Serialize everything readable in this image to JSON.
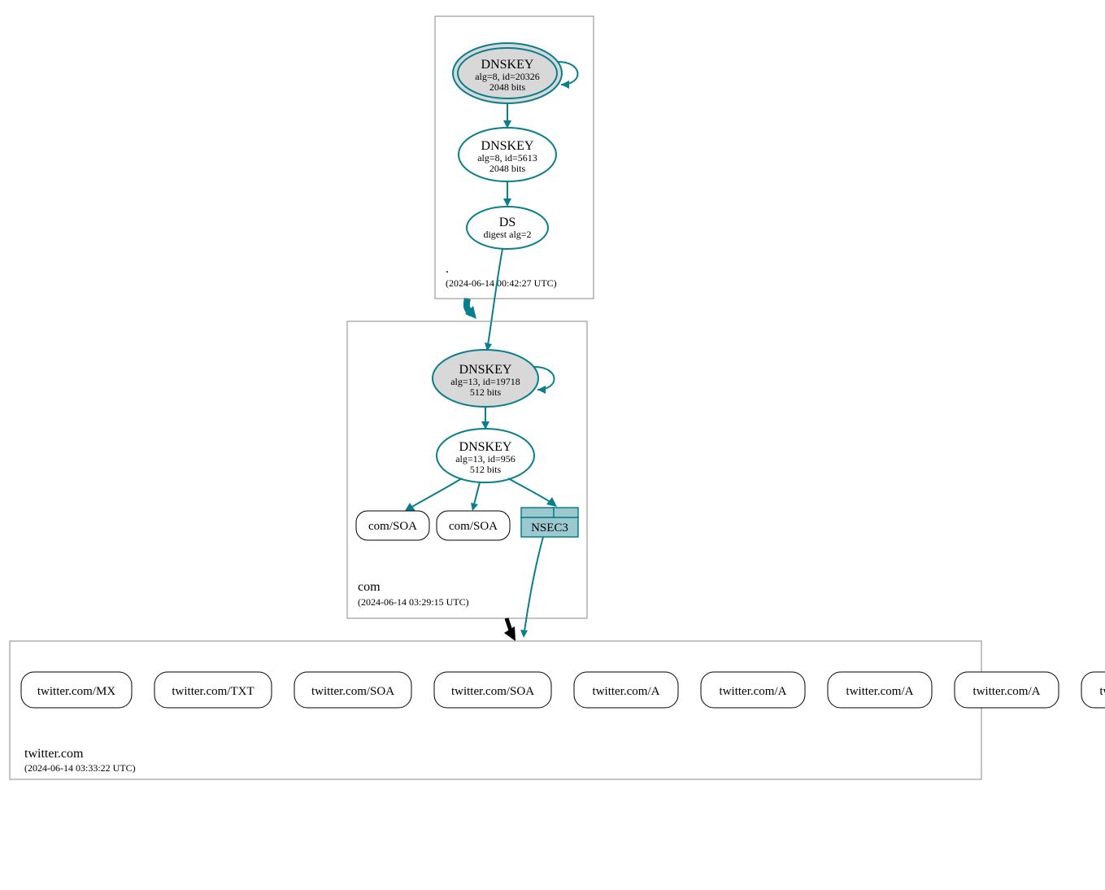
{
  "colors": {
    "teal": "#0a7e8c",
    "sep_fill": "#d8d8d8",
    "nsec3_fill": "#9cc8cf",
    "box_stroke": "#888888"
  },
  "zones": {
    "root": {
      "name": ".",
      "timestamp": "(2024-06-14 00:42:27 UTC)",
      "nodes": {
        "ksk": {
          "title": "DNSKEY",
          "line2": "alg=8, id=20326",
          "line3": "2048 bits"
        },
        "zsk": {
          "title": "DNSKEY",
          "line2": "alg=8, id=5613",
          "line3": "2048 bits"
        },
        "ds": {
          "title": "DS",
          "line2": "digest alg=2"
        }
      }
    },
    "com": {
      "name": "com",
      "timestamp": "(2024-06-14 03:29:15 UTC)",
      "nodes": {
        "ksk": {
          "title": "DNSKEY",
          "line2": "alg=13, id=19718",
          "line3": "512 bits"
        },
        "zsk": {
          "title": "DNSKEY",
          "line2": "alg=13, id=956",
          "line3": "512 bits"
        },
        "soa1": {
          "label": "com/SOA"
        },
        "soa2": {
          "label": "com/SOA"
        },
        "nsec3": {
          "label": "NSEC3"
        }
      }
    },
    "twitter": {
      "name": "twitter.com",
      "timestamp": "(2024-06-14 03:33:22 UTC)",
      "records": [
        "twitter.com/MX",
        "twitter.com/TXT",
        "twitter.com/SOA",
        "twitter.com/SOA",
        "twitter.com/A",
        "twitter.com/A",
        "twitter.com/A",
        "twitter.com/A",
        "twitter.com/NS"
      ]
    }
  }
}
